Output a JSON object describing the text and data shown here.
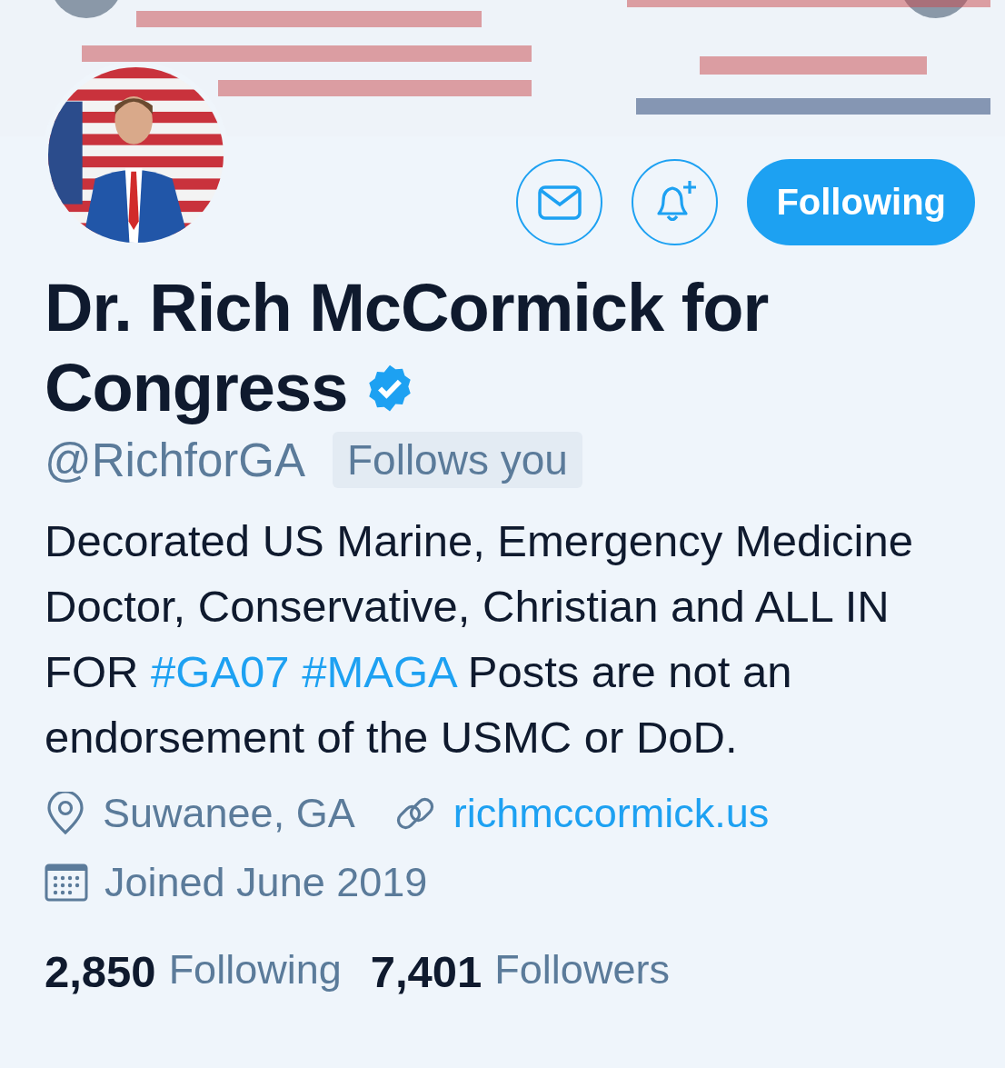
{
  "actions": {
    "icon_buttons": [
      {
        "kind": "message"
      },
      {
        "kind": "notifications"
      }
    ],
    "follow_button": {
      "label": "Following",
      "selected": true
    }
  },
  "profile": {
    "name_line_1": "Dr. Rich McCormick for",
    "name_line_2": "Congress",
    "verified": true,
    "handle": "@RichforGA",
    "follows_you": "Follows you"
  },
  "bio": [
    {
      "kind": "text",
      "text": "Decorated US Marine, Emergency Medicine Doctor, Conservative, Christian and ALL IN FOR "
    },
    {
      "kind": "hashtag",
      "text": "#GA07"
    },
    {
      "kind": "hashtag",
      "text": "#MAGA"
    },
    {
      "kind": "text",
      "text": " Posts are not an endorsement of the USMC or DoD."
    }
  ],
  "details": {
    "location": "Suwanee, GA",
    "website": "richmccormick.us",
    "joined": "Joined June 2019"
  },
  "stats": [
    {
      "count": "2,850",
      "label": "Following"
    },
    {
      "count": "7,401",
      "label": "Followers"
    }
  ]
}
